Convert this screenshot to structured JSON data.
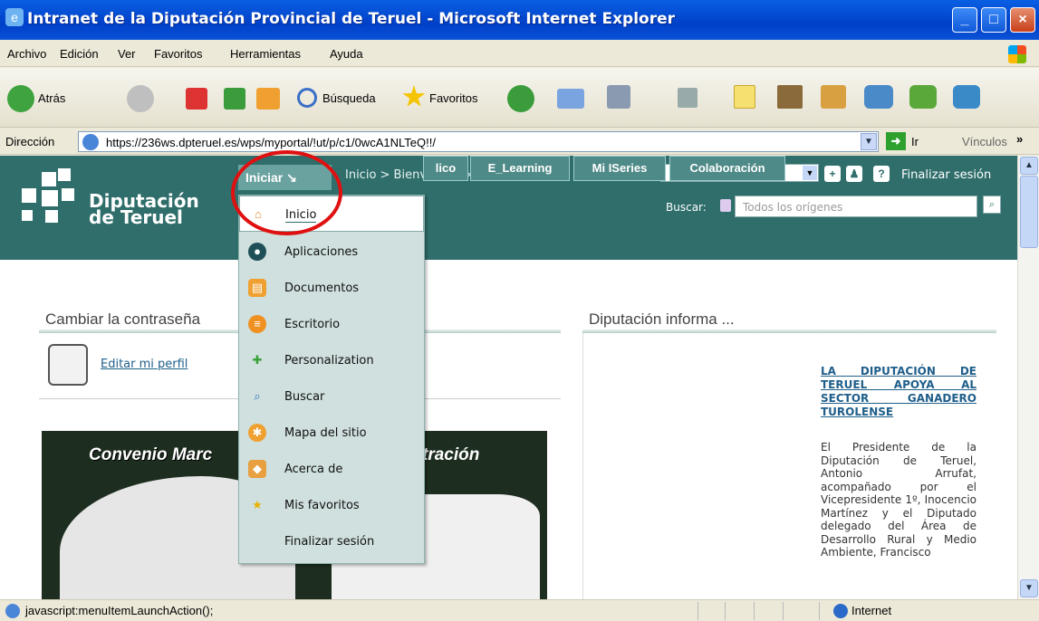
{
  "window": {
    "title": "Intranet de la Diputación Provincial de Teruel - Microsoft Internet Explorer",
    "min": "_",
    "max": "□",
    "close": "×"
  },
  "menubar": [
    "Archivo",
    "Edición",
    "Ver",
    "Favoritos",
    "Herramientas",
    "Ayuda"
  ],
  "toolbar": {
    "back": "Atrás",
    "search": "Búsqueda",
    "favorites": "Favoritos"
  },
  "address": {
    "label": "Dirección",
    "url": "https://236ws.dpteruel.es/wps/myportal/!ut/p/c1/0wcA1NLTeQ!!/",
    "go": "Ir",
    "links": "Vínculos",
    "more": "»"
  },
  "portal": {
    "logo_line1": "Diputación",
    "logo_line2": "de Teruel",
    "start_button": "Iniciar ↘",
    "breadcrumb": "Inicio > Bienvenido >",
    "logout": "Finalizar sesión",
    "search_label": "Buscar:",
    "search_placeholder": "Todos los orígenes",
    "tabs": [
      "lico",
      "E_Learning",
      "Mi ISeries",
      "Colaboración"
    ]
  },
  "start_menu": {
    "items": [
      {
        "label": "Inicio",
        "icon": "home-icon"
      },
      {
        "label": "Aplicaciones",
        "icon": "applications-icon"
      },
      {
        "label": "Documentos",
        "icon": "documents-icon"
      },
      {
        "label": "Escritorio",
        "icon": "desktop-icon"
      },
      {
        "label": "Personalization",
        "icon": "personalization-icon"
      },
      {
        "label": "Buscar",
        "icon": "search-icon"
      },
      {
        "label": "Mapa del sitio",
        "icon": "sitemap-icon"
      },
      {
        "label": "Acerca de",
        "icon": "about-icon"
      },
      {
        "label": "Mis favoritos",
        "icon": "favorites-icon"
      },
      {
        "label": "Finalizar sesión",
        "icon": ""
      }
    ]
  },
  "left_portlet": {
    "title": "Cambiar la contraseña",
    "link": "Editar mi perfil"
  },
  "banner": {
    "text_left": "Convenio Marc",
    "text_right": "tración"
  },
  "right_portlet": {
    "title": "Diputación informa ...",
    "news_title": "LA DIPUTACIÓN DE TERUEL APOYA AL SECTOR GANADERO TUROLENSE",
    "news_body": "El Presidente de la Diputación de Teruel, Antonio Arrufat, acompañado por el Vicepresidente 1º, Inocencio Martínez y el Diputado delegado del Área de Desarrollo Rural y Medio Ambiente, Francisco"
  },
  "status": {
    "text": "javascript:menuItemLaunchAction();",
    "zone": "Internet"
  },
  "colors": {
    "header": "#2f6e6b",
    "menu_bg": "#cfe0de",
    "highlight": "#e01010"
  }
}
